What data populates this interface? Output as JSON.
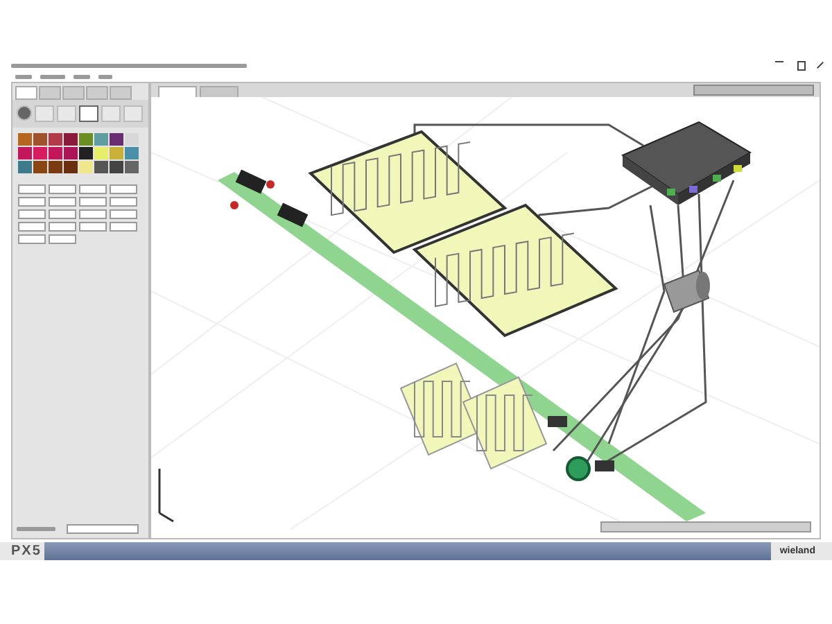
{
  "palette": [
    {
      "color": "#b5651d"
    },
    {
      "color": "#a0522d"
    },
    {
      "color": "#b03a48"
    },
    {
      "color": "#8b1a3a"
    },
    {
      "color": "#6b8e23"
    },
    {
      "color": "#5f9ea0"
    },
    {
      "color": "#6a2c70"
    },
    {
      "color": "#d8d8d8"
    },
    {
      "color": "#c2185b"
    },
    {
      "color": "#d81b60"
    },
    {
      "color": "#c2185b"
    },
    {
      "color": "#ad1457"
    },
    {
      "color": "#222222"
    },
    {
      "color": "#e6ee6a"
    },
    {
      "color": "#c9b037"
    },
    {
      "color": "#4a8fa8"
    },
    {
      "color": "#3d7a8c"
    },
    {
      "color": "#8b4513"
    },
    {
      "color": "#7a3b12"
    },
    {
      "color": "#6b2e0e"
    },
    {
      "color": "#f0e68c"
    },
    {
      "color": "#555555"
    },
    {
      "color": "#444444"
    },
    {
      "color": "#666666"
    }
  ],
  "panel_tabs": [
    {
      "selected": true
    },
    {
      "selected": false
    },
    {
      "selected": false
    },
    {
      "selected": false
    },
    {
      "selected": false
    }
  ],
  "tools": [
    {
      "selected": false
    },
    {
      "selected": false
    },
    {
      "selected": true
    },
    {
      "selected": false
    },
    {
      "selected": false
    }
  ],
  "view_tabs": [
    {
      "selected": true
    },
    {
      "selected": false
    }
  ],
  "footer": {
    "logo": "PX5",
    "brand": "wieland"
  }
}
